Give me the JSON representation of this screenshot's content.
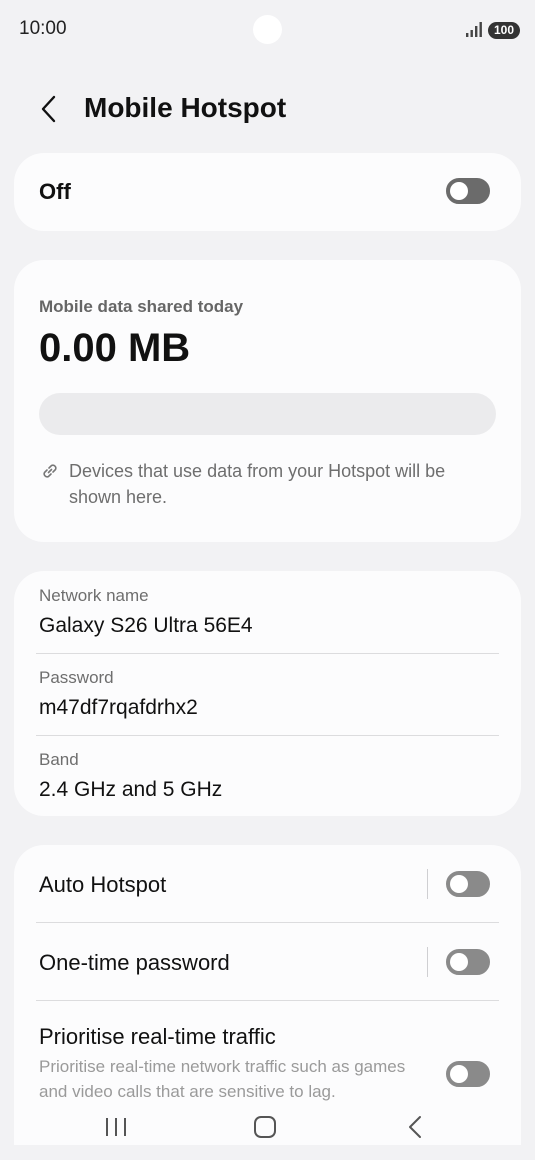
{
  "status_bar": {
    "time": "10:00",
    "battery": "100"
  },
  "header": {
    "title": "Mobile Hotspot"
  },
  "hotspot_toggle": {
    "label": "Off",
    "state": "off"
  },
  "usage": {
    "label": "Mobile data shared today",
    "value": "0.00 MB",
    "bar_fraction": 0,
    "note": "Devices that use data from your Hotspot will be shown here."
  },
  "network": {
    "name_label": "Network name",
    "name_value": "Galaxy S26 Ultra 56E4",
    "password_label": "Password",
    "password_value": "m47df7rqafdrhx2",
    "band_label": "Band",
    "band_value": "2.4 GHz and 5 GHz"
  },
  "settings": {
    "auto_hotspot": {
      "label": "Auto Hotspot",
      "state": "off"
    },
    "one_time_password": {
      "label": "One-time password",
      "state": "off"
    },
    "prioritise": {
      "label": "Prioritise real-time traffic",
      "description": "Prioritise real-time network traffic such as games and video calls that are sensitive to lag.",
      "state": "off"
    }
  },
  "icons": {
    "back": "chevron-left-icon",
    "link": "link-icon",
    "signal": "signal-icon",
    "battery": "battery-icon",
    "nav_recent": "recent-apps-icon",
    "nav_home": "home-icon",
    "nav_back": "back-icon"
  }
}
